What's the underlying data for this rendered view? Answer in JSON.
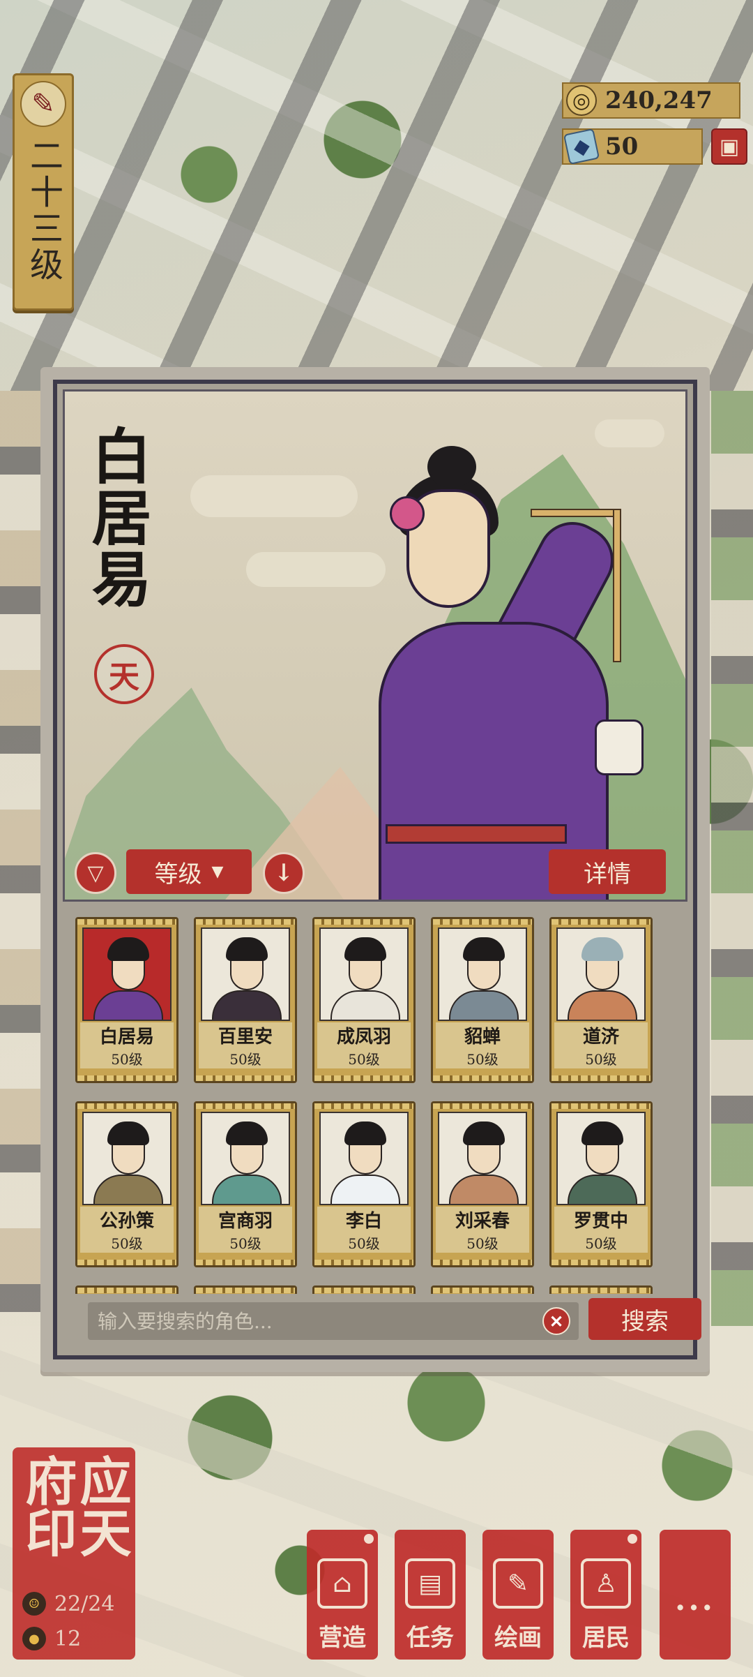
{
  "player": {
    "level_label": "二十三级"
  },
  "currency": {
    "coins": "240,247",
    "gems": "50"
  },
  "portrait": {
    "selected_name": "白居易",
    "seal_char": "天"
  },
  "controls": {
    "sort_label": "等级",
    "detail_label": "详情"
  },
  "characters": [
    {
      "name": "白居易",
      "level": "50级"
    },
    {
      "name": "百里安",
      "level": "50级"
    },
    {
      "name": "成凤羽",
      "level": "50级"
    },
    {
      "name": "貂蝉",
      "level": "50级"
    },
    {
      "name": "道济",
      "level": "50级"
    },
    {
      "name": "公孙策",
      "level": "50级"
    },
    {
      "name": "宫商羽",
      "level": "50级"
    },
    {
      "name": "李白",
      "level": "50级"
    },
    {
      "name": "刘采春",
      "level": "50级"
    },
    {
      "name": "罗贯中",
      "level": "50级"
    }
  ],
  "search": {
    "placeholder": "输入要搜索的角色...",
    "button_label": "搜索"
  },
  "city": {
    "name": "应天府印",
    "population": "22/24",
    "count": "12"
  },
  "nav": [
    {
      "label": "营造",
      "icon": "building-icon"
    },
    {
      "label": "任务",
      "icon": "scroll-icon"
    },
    {
      "label": "绘画",
      "icon": "brush-icon"
    },
    {
      "label": "居民",
      "icon": "resident-icon"
    },
    {
      "label": "...",
      "icon": "more-icon"
    }
  ],
  "colors": {
    "accent_red": "#b4312c",
    "gold": "#c7a452",
    "robe_purple": "#6b3f94"
  }
}
